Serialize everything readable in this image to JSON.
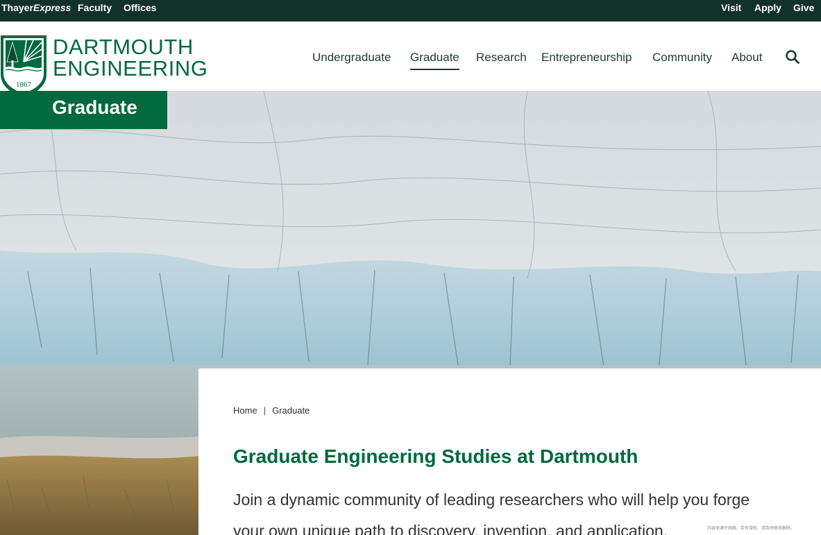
{
  "utility": {
    "thayer": "Thayer",
    "express": "Express",
    "faculty": "Faculty",
    "offices": "Offices",
    "visit": "Visit",
    "apply": "Apply",
    "give": "Give"
  },
  "logo": {
    "line1": "DARTMOUTH",
    "line2": "ENGINEERING",
    "year": "1867"
  },
  "nav": {
    "undergraduate": "Undergraduate",
    "graduate": "Graduate",
    "research": "Research",
    "entrepreneurship": "Entrepreneurship",
    "community": "Community",
    "about": "About"
  },
  "section_badge": "Graduate",
  "breadcrumb": {
    "home": "Home",
    "separator": "|",
    "current": "Graduate"
  },
  "page_title": "Graduate Engineering Studies at Dartmouth",
  "intro": "Join a dynamic community of leading researchers who will help you forge your own unique path to discovery, invention, and application.",
  "watermark": "内容来源于网络，若有侵权，请及时联系删除。",
  "colors": {
    "brand_green": "#00693e",
    "utility_bg": "#12312b",
    "nav_text": "#1f3b34"
  },
  "icons": {
    "search": "search-icon",
    "shield": "dartmouth-shield-logo"
  }
}
